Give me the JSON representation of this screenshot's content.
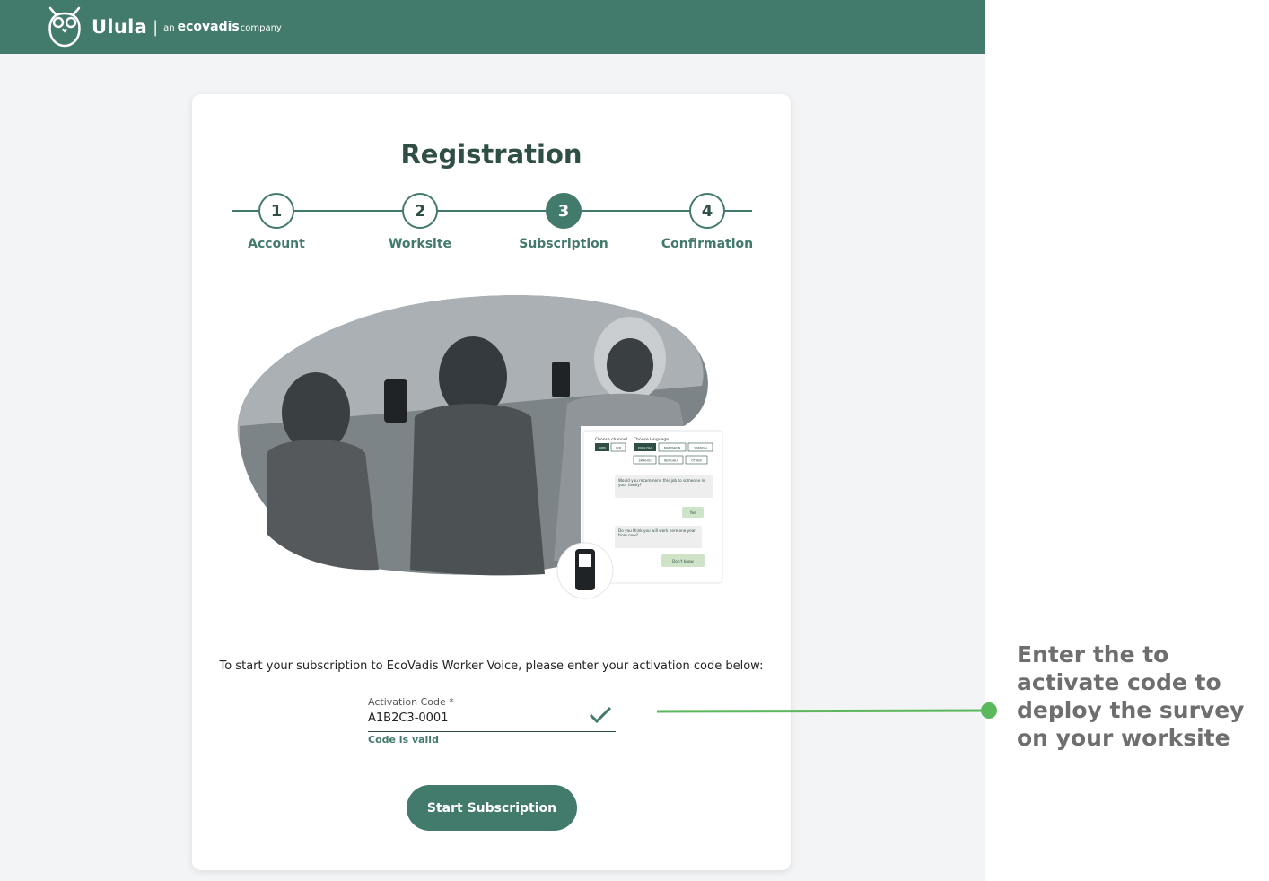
{
  "header": {
    "brand_name": "Ulula",
    "brand_separator": "|",
    "brand_an": "an",
    "brand_eco": "ecovadis",
    "brand_company": "company",
    "color": "#427a6b"
  },
  "registration": {
    "title": "Registration",
    "steps": [
      {
        "number": "1",
        "label": "Account",
        "active": false
      },
      {
        "number": "2",
        "label": "Worksite",
        "active": false
      },
      {
        "number": "3",
        "label": "Subscription",
        "active": true
      },
      {
        "number": "4",
        "label": "Confirmation",
        "active": false
      }
    ]
  },
  "illustration": {
    "choose_channel": "Choose channel",
    "channels": [
      "SMS",
      "IVR"
    ],
    "choose_language": "Choose language",
    "languages": [
      "ENGLISH",
      "MANDARIN",
      "SPANISH",
      "SWAHILI",
      "BENGALI",
      "OTHER"
    ],
    "question_1": "Would you recommend this job to someone in your family?",
    "answer_1": "Yes",
    "question_2": "Do you think you will work here one year from now?",
    "answer_2": "Don't know"
  },
  "subscription": {
    "instruction": "To start your subscription to EcoVadis Worker Voice, please enter your activation code below:",
    "field_label": "Activation Code *",
    "field_value": "A1B2C3-0001",
    "valid_message": "Code is valid",
    "button_label": "Start Subscription"
  },
  "annotation": {
    "text": "Enter the to activate code to deploy the survey on your worksite",
    "color": "#5cb85c"
  }
}
